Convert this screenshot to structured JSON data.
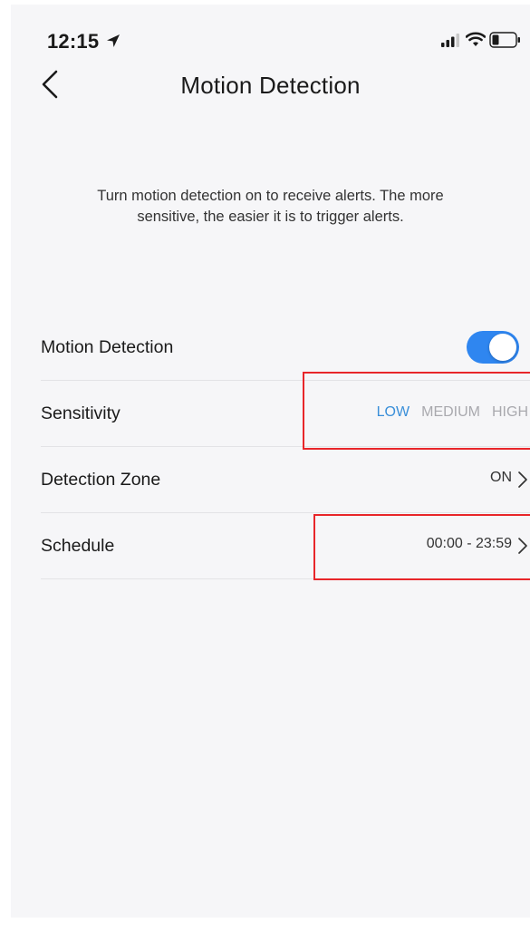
{
  "status": {
    "time": "12:15"
  },
  "nav": {
    "title": "Motion Detection"
  },
  "description": "Turn motion detection on to receive alerts. The more sensitive, the easier it is to trigger alerts.",
  "rows": {
    "motion": {
      "label": "Motion Detection",
      "enabled": true
    },
    "sensitivity": {
      "label": "Sensitivity",
      "options": [
        "LOW",
        "MEDIUM",
        "HIGH"
      ],
      "selected": "LOW"
    },
    "zone": {
      "label": "Detection Zone",
      "value": "ON"
    },
    "schedule": {
      "label": "Schedule",
      "value": "00:00 - 23:59"
    }
  },
  "colors": {
    "accent": "#3a8fd9",
    "toggle_on": "#2f86f0",
    "highlight": "#e8262a"
  },
  "icons": [
    "location-arrow-icon",
    "signal-icon",
    "wifi-icon",
    "battery-icon",
    "back-chevron-icon",
    "chevron-right-icon"
  ]
}
